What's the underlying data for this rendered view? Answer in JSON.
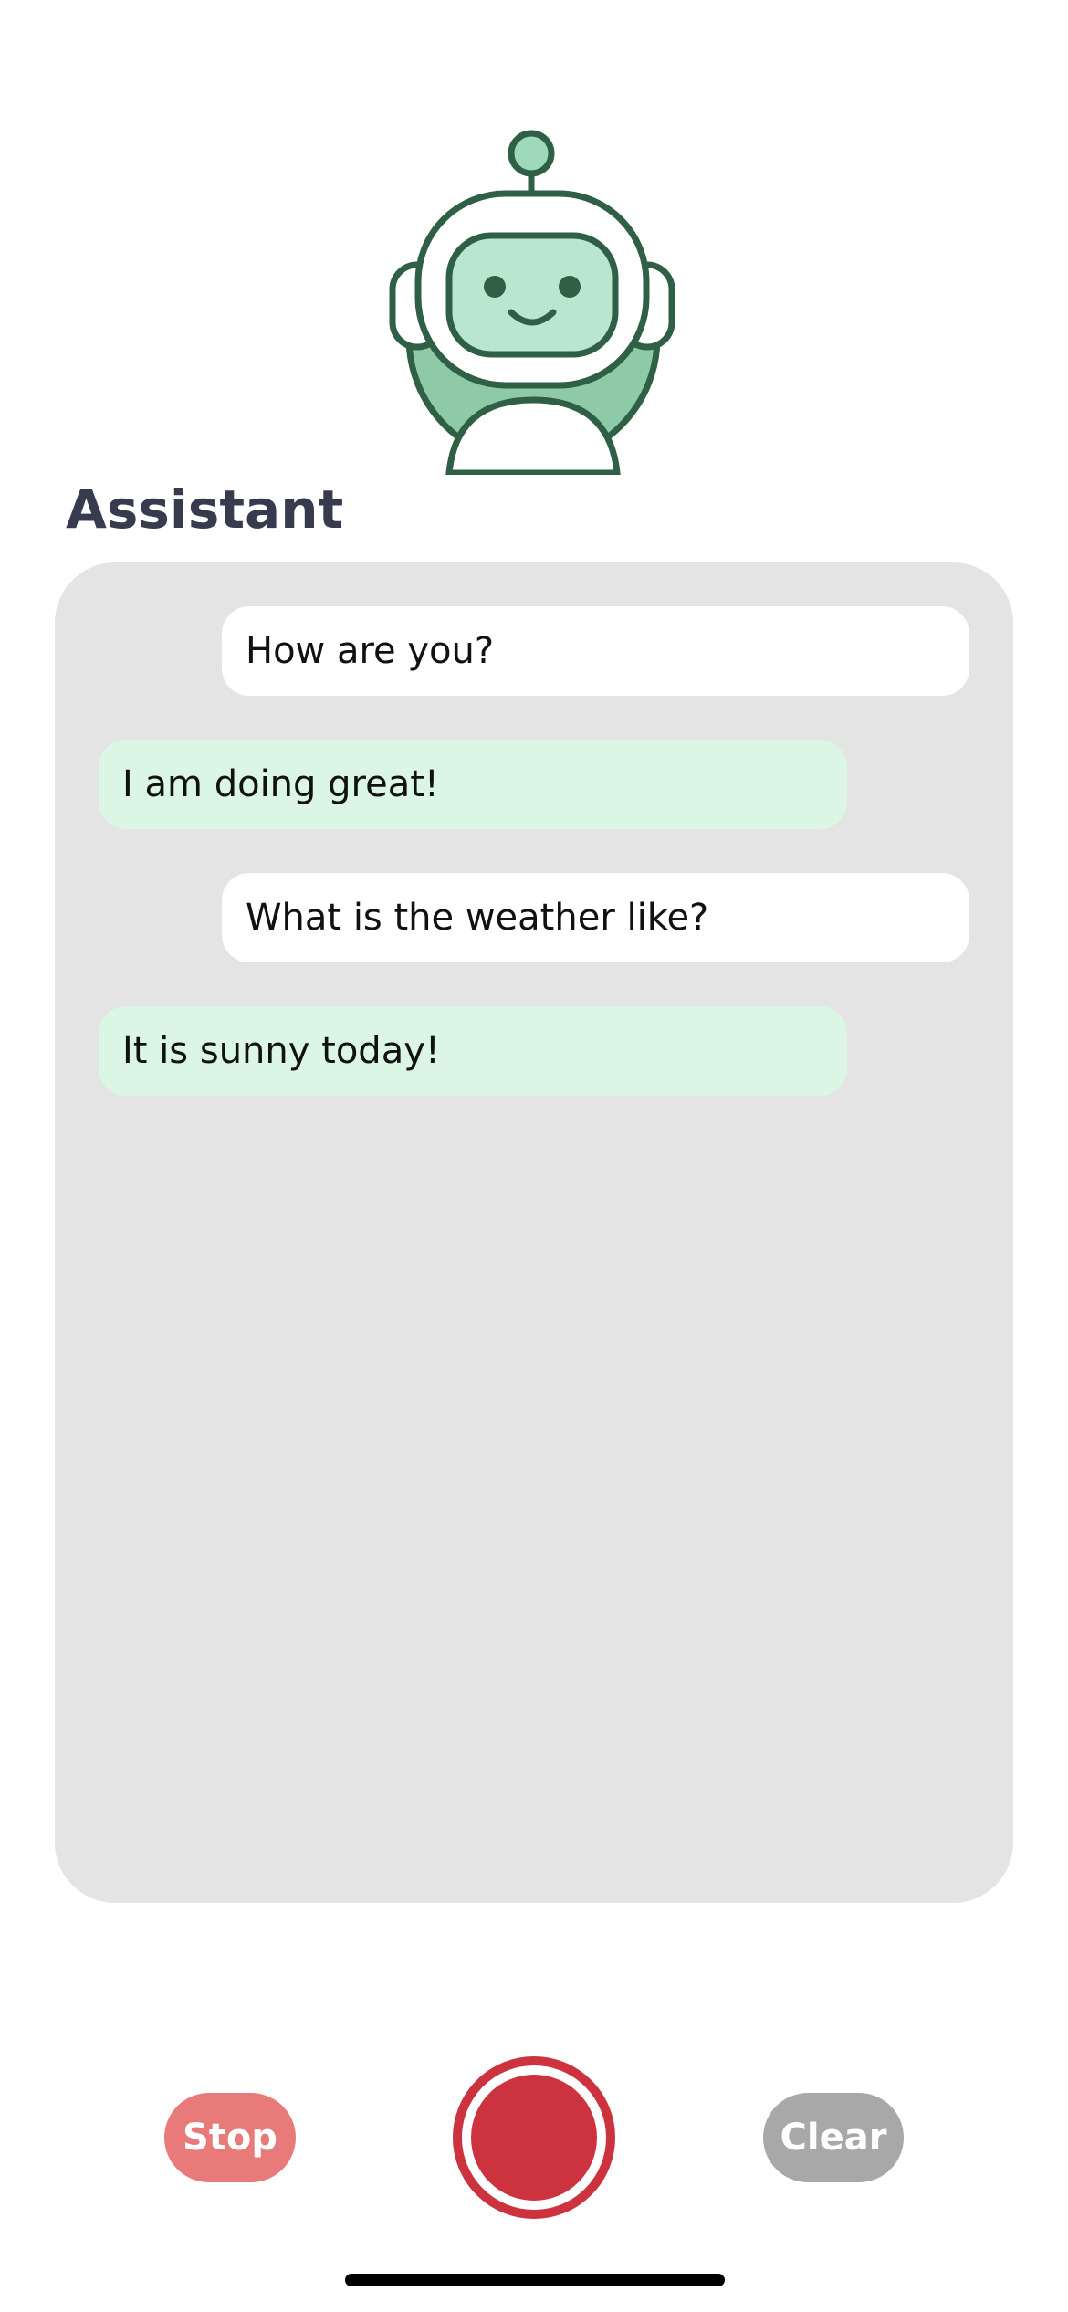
{
  "assistant": {
    "title": "Assistant",
    "avatar_icon": "robot-icon"
  },
  "messages": [
    {
      "role": "user",
      "text": "How are you?"
    },
    {
      "role": "assistant",
      "text": "I am doing great!"
    },
    {
      "role": "user",
      "text": "What is the weather like?"
    },
    {
      "role": "assistant",
      "text": "It is sunny today!"
    }
  ],
  "controls": {
    "stop_label": "Stop",
    "clear_label": "Clear",
    "record_icon": "record-icon"
  },
  "colors": {
    "user_bubble": "#ffffff",
    "assistant_bubble": "#dbf6e4",
    "panel": "#e4e4e4",
    "stop": "#e87a79",
    "clear": "#a8a8a8",
    "record": "#cc333f"
  }
}
